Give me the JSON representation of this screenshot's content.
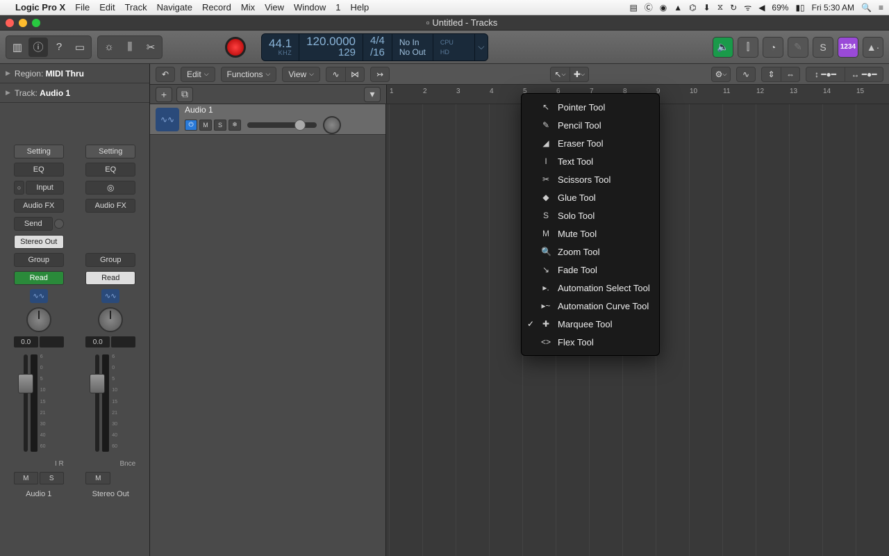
{
  "menubar": {
    "app": "Logic Pro X",
    "items": [
      "File",
      "Edit",
      "Track",
      "Navigate",
      "Record",
      "Mix",
      "View",
      "Window",
      "1",
      "Help"
    ],
    "battery": "69%",
    "clock": "Fri 5:30 AM"
  },
  "window": {
    "title": "Untitled - Tracks"
  },
  "lcd": {
    "sample_rate": "44.1",
    "sr_label": "KHZ",
    "tempo": "120.0000",
    "bars": "129",
    "sig_top": "4/4",
    "sig_bottom": "/16",
    "in": "No In",
    "out": "No Out",
    "cpu": "CPU",
    "hd": "HD"
  },
  "right_tools": {
    "master_num": "1234"
  },
  "inspector": {
    "region_label": "Region:",
    "region_val": "MIDI Thru",
    "track_label": "Track:",
    "track_val": "Audio 1",
    "buttons": {
      "setting": "Setting",
      "eq": "EQ",
      "input": "Input",
      "audiofx": "Audio FX",
      "send": "Send",
      "stereo_out": "Stereo Out",
      "group": "Group",
      "read": "Read",
      "bnce": "Bnce"
    },
    "val": "0.0",
    "ir": "I  R",
    "mute": "M",
    "solo": "S",
    "ch1_name": "Audio 1",
    "ch2_name": "Stereo Out",
    "scale": [
      "6",
      "0",
      "5",
      "10",
      "15",
      "21",
      "30",
      "40",
      "60"
    ]
  },
  "arrange": {
    "menus": {
      "edit": "Edit",
      "functions": "Functions",
      "view": "View"
    },
    "ruler_marks": [
      "1",
      "2",
      "3",
      "4",
      "5",
      "6",
      "7",
      "8",
      "9",
      "10",
      "11",
      "12",
      "13",
      "14",
      "15"
    ],
    "track": {
      "name": "Audio 1",
      "mute": "M",
      "solo": "S"
    }
  },
  "toolmenu": {
    "items": [
      {
        "icon": "↖",
        "label": "Pointer Tool",
        "checked": false
      },
      {
        "icon": "✎",
        "label": "Pencil Tool",
        "checked": false
      },
      {
        "icon": "◢",
        "label": "Eraser Tool",
        "checked": false
      },
      {
        "icon": "I",
        "label": "Text Tool",
        "checked": false
      },
      {
        "icon": "✂",
        "label": "Scissors Tool",
        "checked": false
      },
      {
        "icon": "◆",
        "label": "Glue Tool",
        "checked": false
      },
      {
        "icon": "S",
        "label": "Solo Tool",
        "checked": false
      },
      {
        "icon": "M",
        "label": "Mute Tool",
        "checked": false
      },
      {
        "icon": "🔍",
        "label": "Zoom Tool",
        "checked": false
      },
      {
        "icon": "↘",
        "label": "Fade Tool",
        "checked": false
      },
      {
        "icon": "▸.",
        "label": "Automation Select Tool",
        "checked": false
      },
      {
        "icon": "▸~",
        "label": "Automation Curve Tool",
        "checked": false
      },
      {
        "icon": "✚",
        "label": "Marquee Tool",
        "checked": true
      },
      {
        "icon": "<>",
        "label": "Flex Tool",
        "checked": false
      }
    ]
  }
}
